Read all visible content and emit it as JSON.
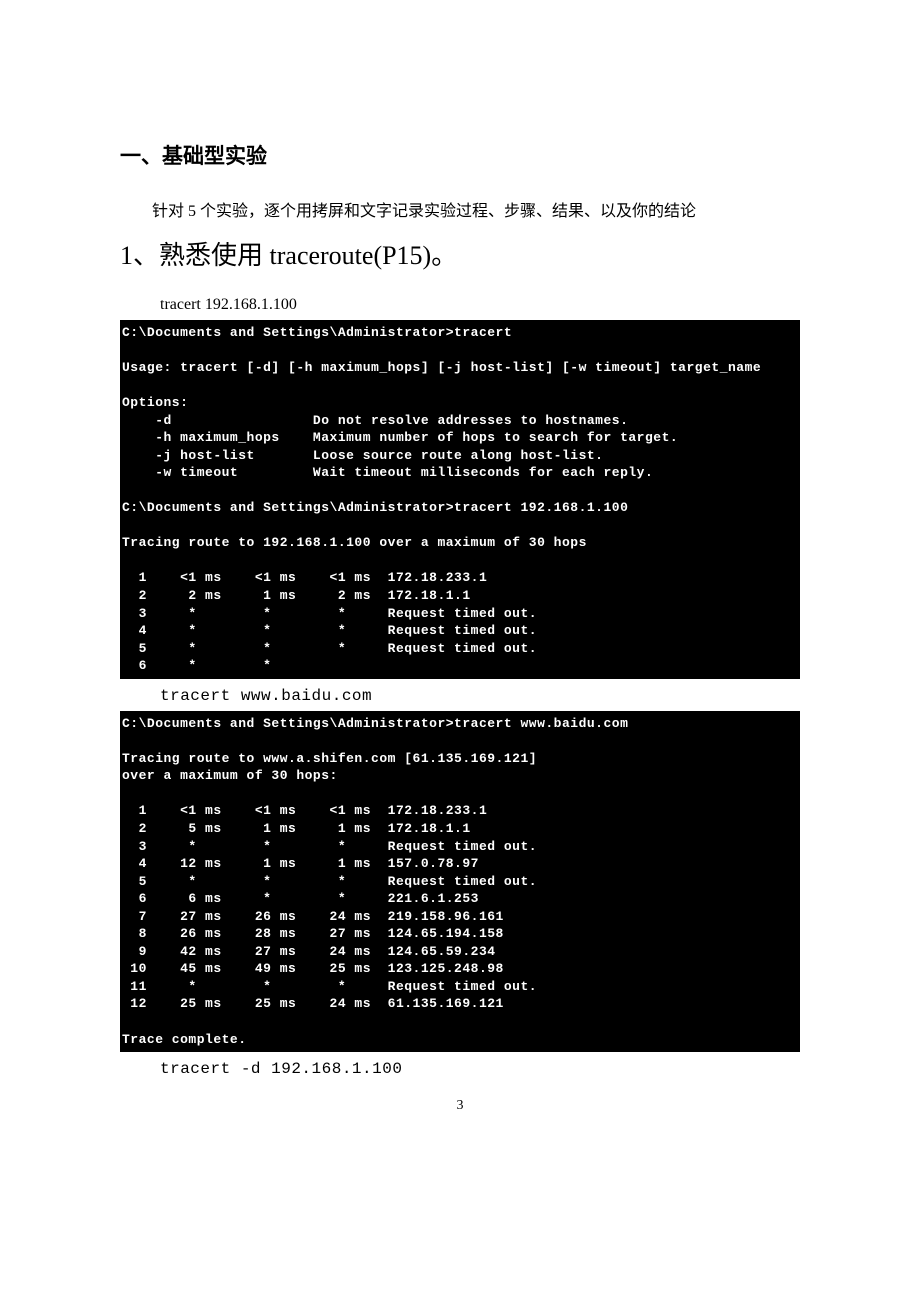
{
  "heading_main": "一、基础型实验",
  "intro_text": "针对 5 个实验，逐个用拷屏和文字记录实验过程、步骤、结果、以及你的结论",
  "heading_sub_prefix": "1、熟悉使用 ",
  "heading_sub_roman": "traceroute(P15)",
  "heading_sub_suffix": "。",
  "cmd1": "tracert 192.168.1.100",
  "terminal1": "C:\\Documents and Settings\\Administrator>tracert\n\nUsage: tracert [-d] [-h maximum_hops] [-j host-list] [-w timeout] target_name\n\nOptions:\n    -d                 Do not resolve addresses to hostnames.\n    -h maximum_hops    Maximum number of hops to search for target.\n    -j host-list       Loose source route along host-list.\n    -w timeout         Wait timeout milliseconds for each reply.\n\nC:\\Documents and Settings\\Administrator>tracert 192.168.1.100\n\nTracing route to 192.168.1.100 over a maximum of 30 hops\n\n  1    <1 ms    <1 ms    <1 ms  172.18.233.1\n  2     2 ms     1 ms     2 ms  172.18.1.1\n  3     *        *        *     Request timed out.\n  4     *        *        *     Request timed out.\n  5     *        *        *     Request timed out.\n  6     *        *",
  "cmd2": "tracert www.baidu.com",
  "terminal2": "C:\\Documents and Settings\\Administrator>tracert www.baidu.com\n\nTracing route to www.a.shifen.com [61.135.169.121]\nover a maximum of 30 hops:\n\n  1    <1 ms    <1 ms    <1 ms  172.18.233.1\n  2     5 ms     1 ms     1 ms  172.18.1.1\n  3     *        *        *     Request timed out.\n  4    12 ms     1 ms     1 ms  157.0.78.97\n  5     *        *        *     Request timed out.\n  6     6 ms     *        *     221.6.1.253\n  7    27 ms    26 ms    24 ms  219.158.96.161\n  8    26 ms    28 ms    27 ms  124.65.194.158\n  9    42 ms    27 ms    24 ms  124.65.59.234\n 10    45 ms    49 ms    25 ms  123.125.248.98\n 11     *        *        *     Request timed out.\n 12    25 ms    25 ms    24 ms  61.135.169.121\n\nTrace complete.",
  "cmd3": "tracert -d 192.168.1.100",
  "page_number": "3"
}
